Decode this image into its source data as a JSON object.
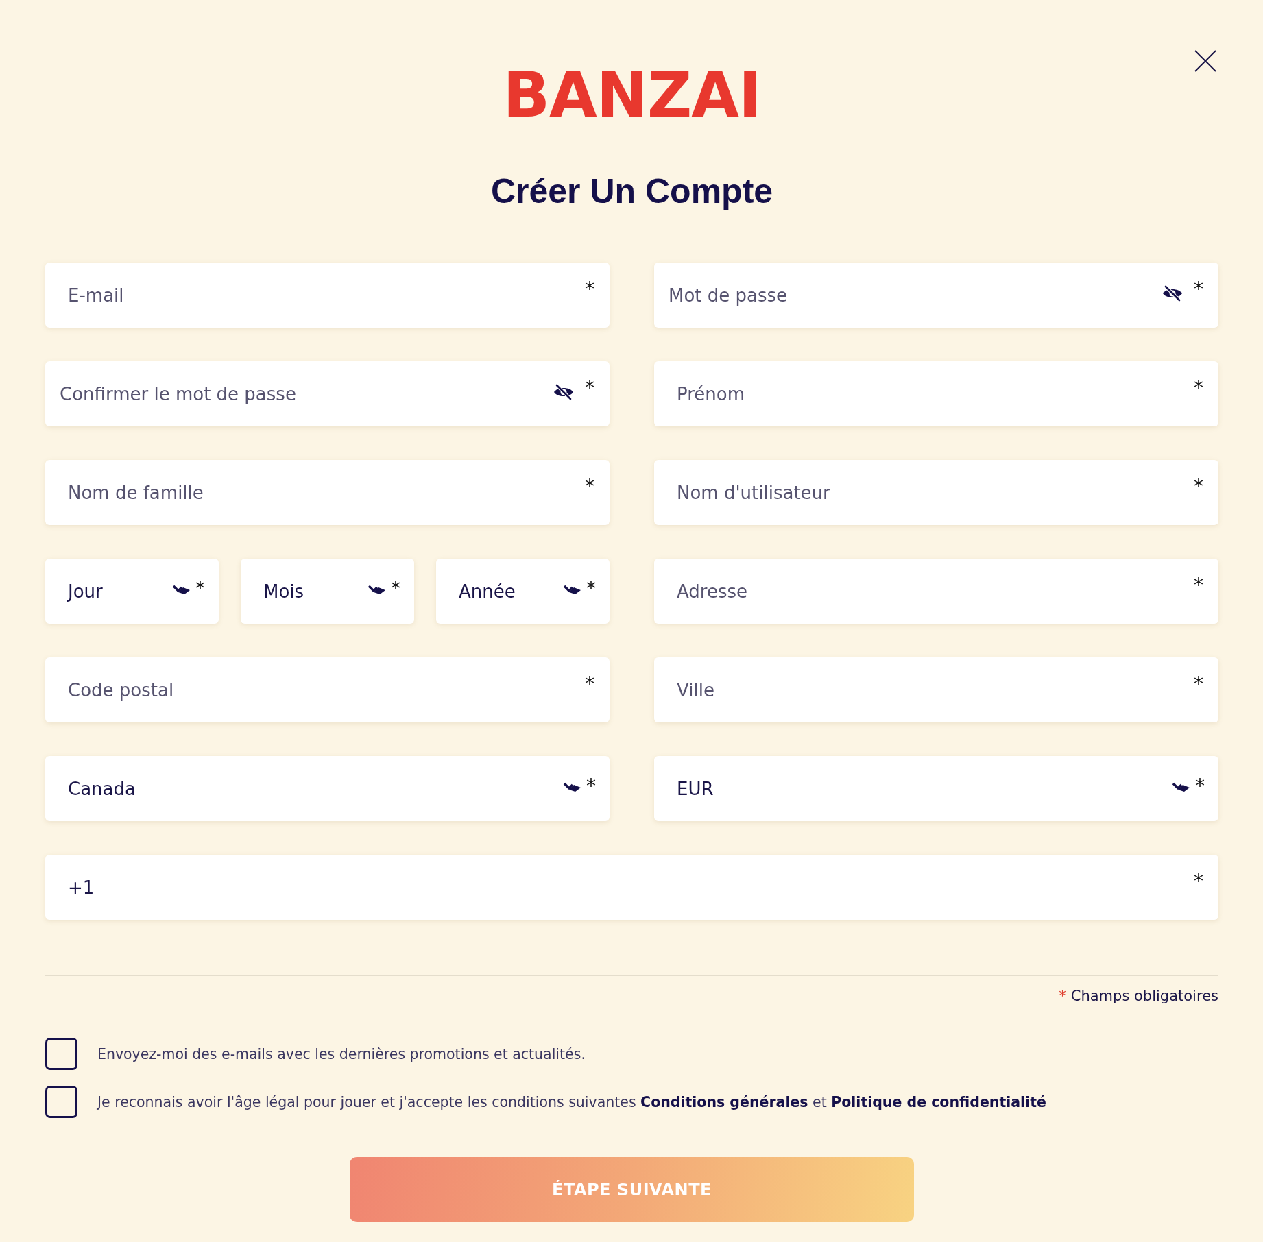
{
  "logo": {
    "text": "BANZAI"
  },
  "title": "Créer Un Compte",
  "form": {
    "rows": [
      {
        "fields": [
          {
            "kind": "text",
            "placeholder": "E-mail",
            "mark": "*"
          },
          {
            "kind": "password",
            "placeholder": "Mot de passe",
            "mark": "*"
          }
        ]
      },
      {
        "fields": [
          {
            "kind": "password",
            "placeholder": "Confirmer le mot de passe",
            "mark": "*"
          },
          {
            "kind": "text",
            "placeholder": "Prénom",
            "mark": "*"
          }
        ]
      },
      {
        "fields": [
          {
            "kind": "text",
            "placeholder": "Nom de famille",
            "mark": "*"
          },
          {
            "kind": "text",
            "placeholder": "Nom d'utilisateur",
            "mark": "*"
          }
        ]
      },
      {
        "fields": [
          {
            "kind": "group",
            "fields": [
              {
                "kind": "select",
                "value": "Jour",
                "mark": "*"
              },
              {
                "kind": "select",
                "value": "Mois",
                "mark": "*"
              },
              {
                "kind": "select",
                "value": "Année",
                "mark": "*"
              }
            ]
          },
          {
            "kind": "text",
            "placeholder": "Adresse",
            "mark": "*"
          }
        ]
      },
      {
        "fields": [
          {
            "kind": "text",
            "placeholder": "Code postal",
            "mark": "*"
          },
          {
            "kind": "text",
            "placeholder": "Ville",
            "mark": "*"
          }
        ]
      },
      {
        "fields": [
          {
            "kind": "select",
            "value": "Canada",
            "mark": "*"
          },
          {
            "kind": "select",
            "value": "EUR",
            "mark": "*"
          }
        ]
      },
      {
        "fields": [
          {
            "kind": "text",
            "value": "+1",
            "mark": "*"
          }
        ]
      }
    ]
  },
  "required_note": {
    "mark": "*",
    "text": "Champs obligatoires"
  },
  "consents": [
    {
      "checked": false,
      "parts": [
        {
          "kind": "text",
          "text": "Envoyez-moi des e-mails avec les dernières promotions et actualités."
        }
      ]
    },
    {
      "checked": false,
      "parts": [
        {
          "kind": "text",
          "text": "Je reconnais avoir l'âge légal pour jouer et j'accepte les conditions suivantes "
        },
        {
          "kind": "link",
          "text": "Conditions générales"
        },
        {
          "kind": "text",
          "text": " et "
        },
        {
          "kind": "link",
          "text": "Politique de confidentialité"
        }
      ]
    }
  ],
  "next_button": {
    "label": "ÉTAPE SUIVANTE"
  }
}
